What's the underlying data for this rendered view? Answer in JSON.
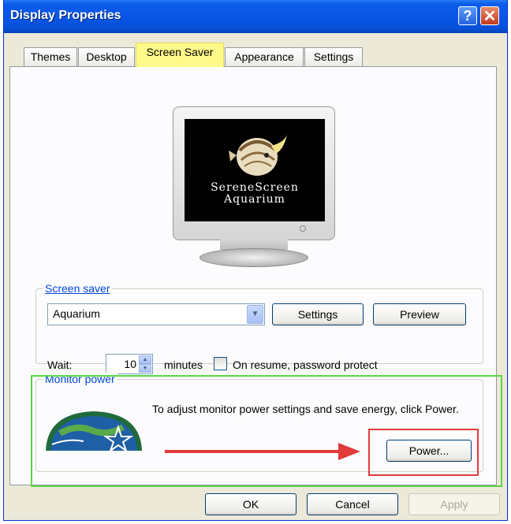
{
  "window": {
    "title": "Display Properties",
    "help_glyph": "?",
    "close_glyph": "✕"
  },
  "tabs": [
    {
      "label": "Themes"
    },
    {
      "label": "Desktop"
    },
    {
      "label": "Screen Saver",
      "active": true
    },
    {
      "label": "Appearance"
    },
    {
      "label": "Settings"
    }
  ],
  "preview": {
    "line1": "SereneScreen",
    "line2": "Aquarium"
  },
  "screen_saver": {
    "group_label": "Screen saver",
    "selected": "Aquarium",
    "settings_label": "Settings",
    "preview_label": "Preview",
    "wait_label": "Wait:",
    "wait_value": "10",
    "minutes_label": "minutes",
    "password_label": "On resume, password protect",
    "password_checked": false
  },
  "monitor_power": {
    "group_label": "Monitor power",
    "description": "To adjust monitor power settings and save energy, click Power.",
    "power_label": "Power..."
  },
  "footer": {
    "ok_label": "OK",
    "cancel_label": "Cancel",
    "apply_label": "Apply"
  },
  "colors": {
    "title_bar": "#0955E6",
    "active_tab_highlight": "#FFF98A",
    "green_highlight": "#5BD746",
    "red_highlight": "#E23A3A",
    "group_label": "#0046D5"
  }
}
